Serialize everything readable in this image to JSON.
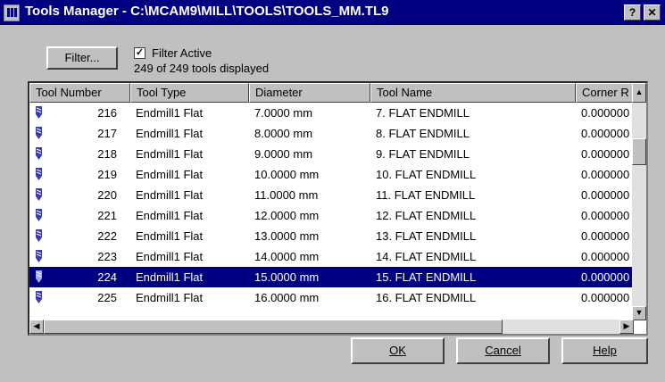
{
  "window": {
    "title": "Tools Manager - C:\\MCAM9\\MILL\\TOOLS\\TOOLS_MM.TL9",
    "help_glyph": "?",
    "close_glyph": "✕"
  },
  "filter": {
    "button_label": "Filter...",
    "active_label": "Filter Active",
    "active_checked": true,
    "check_glyph": "✓",
    "status": "249 of 249 tools displayed"
  },
  "table": {
    "columns": [
      "Tool Number",
      "Tool Type",
      "Diameter",
      "Tool Name",
      "Corner R"
    ],
    "rows": [
      {
        "number": "216",
        "type": "Endmill1 Flat",
        "diameter": "7.0000 mm",
        "name": "7. FLAT ENDMILL",
        "corner": "0.000000"
      },
      {
        "number": "217",
        "type": "Endmill1 Flat",
        "diameter": "8.0000 mm",
        "name": "8. FLAT ENDMILL",
        "corner": "0.000000"
      },
      {
        "number": "218",
        "type": "Endmill1 Flat",
        "diameter": "9.0000 mm",
        "name": "9. FLAT ENDMILL",
        "corner": "0.000000"
      },
      {
        "number": "219",
        "type": "Endmill1 Flat",
        "diameter": "10.0000 mm",
        "name": "10. FLAT ENDMILL",
        "corner": "0.000000"
      },
      {
        "number": "220",
        "type": "Endmill1 Flat",
        "diameter": "11.0000 mm",
        "name": "11. FLAT ENDMILL",
        "corner": "0.000000"
      },
      {
        "number": "221",
        "type": "Endmill1 Flat",
        "diameter": "12.0000 mm",
        "name": "12. FLAT ENDMILL",
        "corner": "0.000000"
      },
      {
        "number": "222",
        "type": "Endmill1 Flat",
        "diameter": "13.0000 mm",
        "name": "13. FLAT ENDMILL",
        "corner": "0.000000"
      },
      {
        "number": "223",
        "type": "Endmill1 Flat",
        "diameter": "14.0000 mm",
        "name": "14. FLAT ENDMILL",
        "corner": "0.000000"
      },
      {
        "number": "224",
        "type": "Endmill1 Flat",
        "diameter": "15.0000 mm",
        "name": "15. FLAT ENDMILL",
        "corner": "0.000000",
        "selected": true
      },
      {
        "number": "225",
        "type": "Endmill1 Flat",
        "diameter": "16.0000 mm",
        "name": "16. FLAT ENDMILL",
        "corner": "0.000000"
      }
    ],
    "scroll_up_glyph": "▲",
    "scroll_down_glyph": "▼",
    "scroll_left_glyph": "◀",
    "scroll_right_glyph": "▶"
  },
  "buttons": {
    "ok": "OK",
    "cancel": "Cancel",
    "help": "Help"
  },
  "colors": {
    "title_bar": "#000080",
    "selection": "#000080",
    "face": "#c0c0c0",
    "tool_icon": "#3a3ab8"
  },
  "icons": {
    "tool_row": "endmill-tool-icon",
    "title": "app-icon"
  }
}
